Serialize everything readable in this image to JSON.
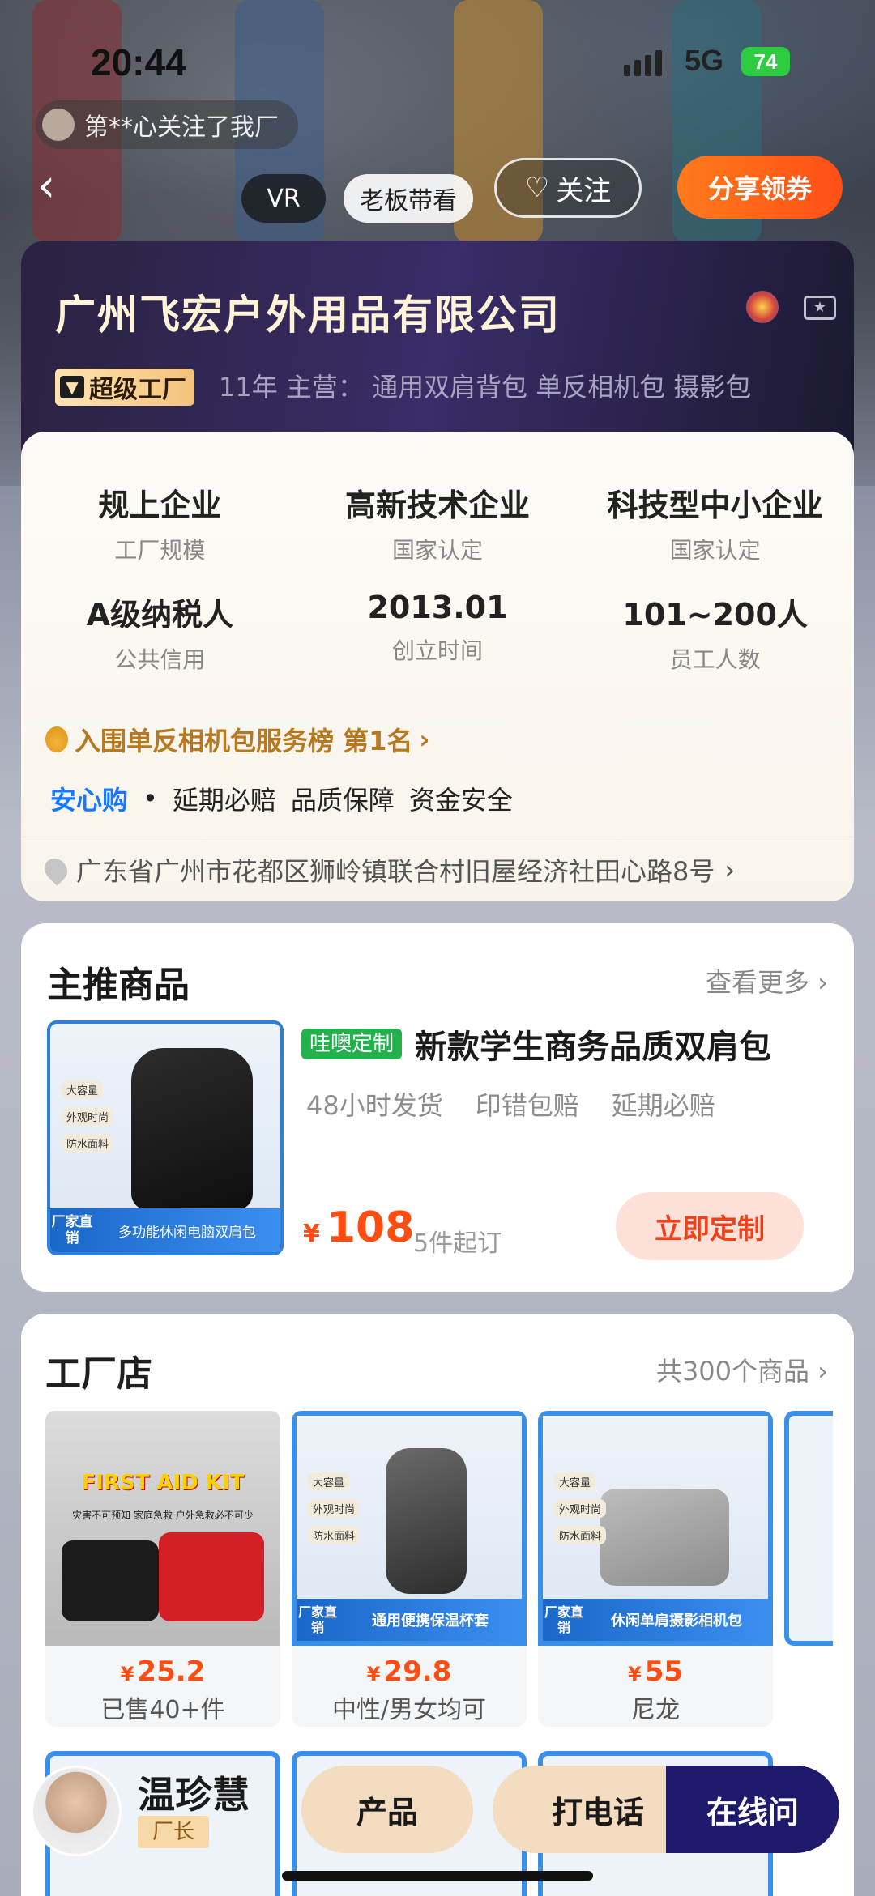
{
  "status_bar": {
    "time": "20:44",
    "network": "5G",
    "battery": "74"
  },
  "toast": {
    "text": "第**心关注了我厂"
  },
  "top_actions": {
    "back_glyph": "‹",
    "vr_label": "VR",
    "boss_label": "老板带看",
    "follow_label": "关注",
    "share_label": "分享领券"
  },
  "company": {
    "name": "广州飞宏户外用品有限公司",
    "badge_label": "超级工厂",
    "badge_glyph": "▼",
    "meta": "11年  主营：  通用双肩背包 单反相机包 摄影包",
    "icons": [
      "police-badge-icon",
      "id-card-icon"
    ]
  },
  "info": {
    "cells": [
      {
        "value": "规上企业",
        "label": "工厂规模"
      },
      {
        "value": "高新技术企业",
        "label": "国家认定"
      },
      {
        "value": "科技型中小企业",
        "label": "国家认定"
      },
      {
        "value": "A级纳税人",
        "label": "公共信用"
      },
      {
        "value": "2013.01",
        "label": "创立时间"
      },
      {
        "value": "101~200人",
        "label": "员工人数"
      }
    ],
    "rank_text": "入围单反相机包服务榜 第1名",
    "rank_arrow": "›",
    "assure_brand": "安心购",
    "assure_dot": "•",
    "assure_items": [
      "延期必赔",
      "品质保障",
      "资金安全"
    ],
    "address": "广东省广州市花都区狮岭镇联合村旧屋经济社田心路8号",
    "address_arrow": "›"
  },
  "featured": {
    "title": "主推商品",
    "more": "查看更多 ›",
    "tag": "哇噢定制",
    "product_title": "新款学生商务品质双肩包",
    "perks": [
      "48小时发货",
      "印错包赔",
      "延期必赔"
    ],
    "currency": "¥",
    "price": "108",
    "moq": "5件起订",
    "buy_label": "立即定制",
    "thumb": {
      "tags": [
        "大容量",
        "外观时尚",
        "防水面料"
      ],
      "footer_left": "厂家直销",
      "footer_right": "多功能休闲电脑双肩包"
    }
  },
  "store": {
    "title": "工厂店",
    "count": "共300个商品 ›",
    "products": [
      {
        "kind": "kit",
        "kit_title": "FIRST AID KIT",
        "kit_sub": "灾害不可预知 家庭急救 户外急救必不可少",
        "price": "25.2",
        "sub": "已售40+件"
      },
      {
        "kind": "bottle",
        "tags": [
          "大容量",
          "外观时尚",
          "防水面料"
        ],
        "footer_left": "厂家直销",
        "footer_right": "通用便携保温杯套",
        "price": "29.8",
        "sub": "中性/男女均可"
      },
      {
        "kind": "camera",
        "tags": [
          "大容量",
          "外观时尚",
          "防水面料"
        ],
        "footer_left": "厂家直销",
        "footer_right": "休闲单肩摄影相机包",
        "price": "55",
        "sub": "尼龙"
      }
    ]
  },
  "bottom_bar": {
    "manager_name": "温珍慧",
    "manager_role": "厂长",
    "product_label": "产品",
    "call_label": "打电话",
    "chat_label": "在线问"
  }
}
